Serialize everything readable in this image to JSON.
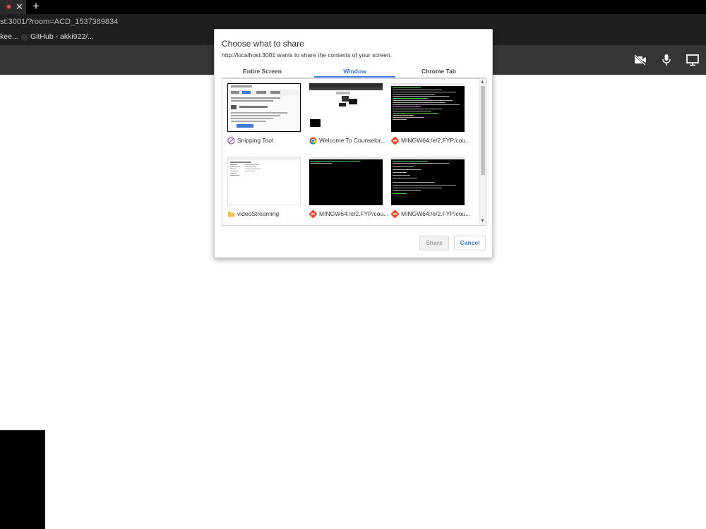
{
  "browser": {
    "url": "st:3001/?room=ACD_1537389834",
    "bookmarks": [
      "kee...",
      "GitHub - akki922/..."
    ],
    "newtab_glyph": "+",
    "close_glyph": "✕"
  },
  "dialog": {
    "title": "Choose what to share",
    "subtitle": "http://localhost:3001 wants to share the contents of your screen.",
    "tabs": [
      {
        "label": "Entire Screen",
        "active": false
      },
      {
        "label": "Window",
        "active": true
      },
      {
        "label": "Chrome Tab",
        "active": false
      }
    ],
    "windows": [
      {
        "label": "Snipping Tool",
        "icon": "snipping-tool-icon"
      },
      {
        "label": "Welcome To Counselor...",
        "icon": "chrome-icon"
      },
      {
        "label": "MINGW64:/e/2.FYP/cou...",
        "icon": "git-bash-icon"
      },
      {
        "label": "videoStreaming",
        "icon": "folder-icon"
      },
      {
        "label": "MINGW64:/e/2.FYP/cou...",
        "icon": "git-bash-icon"
      },
      {
        "label": "MINGW64:/e/2.FYP/cou...",
        "icon": "git-bash-icon"
      }
    ],
    "share_label": "Share",
    "cancel_label": "Cancel"
  },
  "colors": {
    "accent": "#3b78d8",
    "header": "#353535"
  }
}
